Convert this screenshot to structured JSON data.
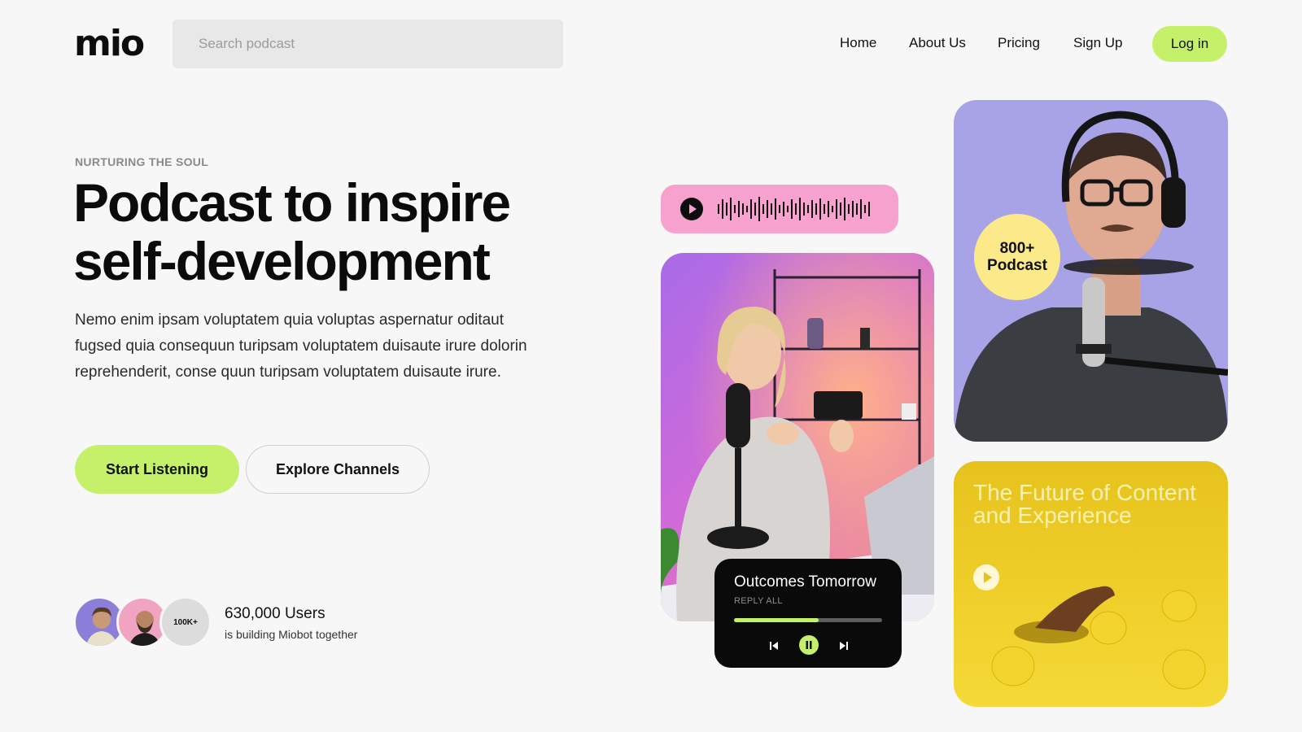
{
  "brand": {
    "logo": "mio"
  },
  "search": {
    "placeholder": "Search podcast"
  },
  "nav": {
    "items": [
      "Home",
      "About Us",
      "Pricing",
      "Sign Up"
    ],
    "login_label": "Log in"
  },
  "hero": {
    "eyebrow": "NURTURING THE SOUL",
    "headline_line1": "Podcast to inspire",
    "headline_line2": "self-development",
    "body": "Nemo enim ipsam voluptatem quia voluptas aspernatur oditaut fugsed quia consequun turipsam voluptatem duisaute irure dolorin reprehenderit, conse quun turipsam voluptatem duisaute irure.",
    "primary_button": "Start Listening",
    "secondary_button": "Explore Channels"
  },
  "users": {
    "badge_count": "100K+",
    "count": "630,000 Users",
    "subtitle": "is building Miobot together"
  },
  "audio_pill": {
    "icon": "play-icon"
  },
  "player": {
    "title": "Outcomes Tomorrow",
    "subtitle": "REPLY ALL",
    "progress": 0.57
  },
  "podcast_badge": {
    "line1": "800+",
    "line2": "Podcast"
  },
  "feature_card": {
    "title": "The Future of Content and Experience"
  },
  "colors": {
    "accent_green": "#c4f06a",
    "pink": "#f7a1cf",
    "lavender": "#a7a3e6",
    "yellow": "#f0cf2a",
    "badge_yellow": "#fbe98a"
  }
}
